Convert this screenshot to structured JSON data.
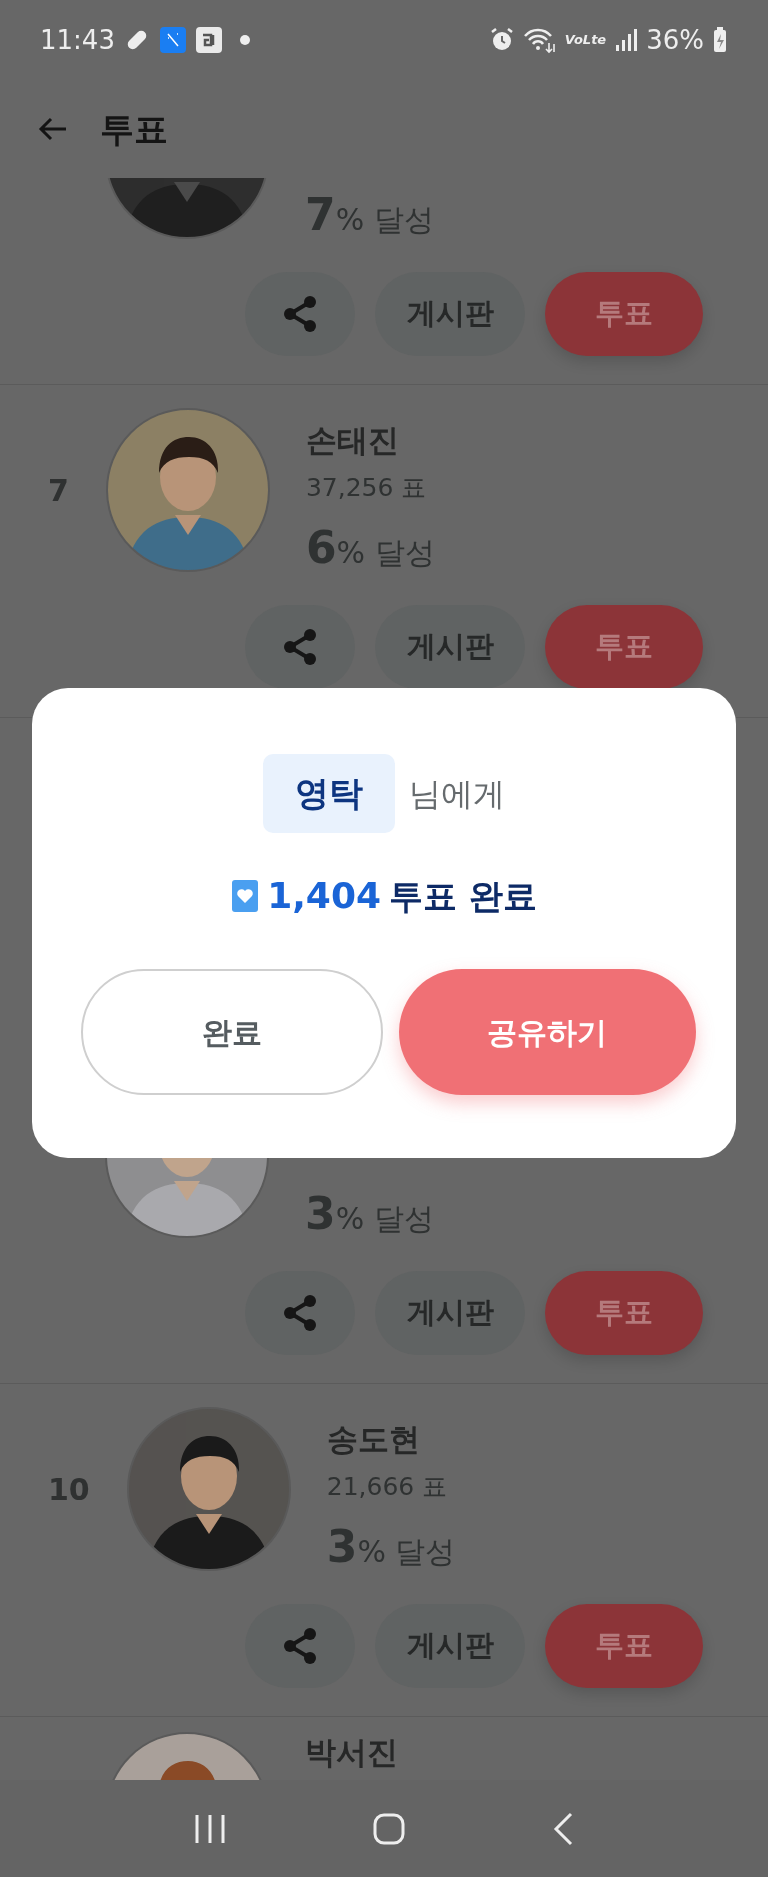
{
  "status_bar": {
    "time": "11:43",
    "network_label": "VoLte",
    "battery": "36%"
  },
  "header": {
    "title": "투표"
  },
  "candidates": [
    {
      "percent": "7",
      "percent_suffix": "% 달성",
      "board_label": "게시판",
      "vote_label": "투표"
    },
    {
      "rank": "7",
      "name": "손태진",
      "votes": "37,256 표",
      "percent": "6",
      "percent_suffix": "% 달성",
      "board_label": "게시판",
      "vote_label": "투표"
    },
    {
      "percent": "3",
      "percent_suffix": "% 달성",
      "board_label": "게시판",
      "vote_label": "투표"
    },
    {
      "rank": "10",
      "name": "송도현",
      "votes": "21,666 표",
      "percent": "3",
      "percent_suffix": "% 달성",
      "board_label": "게시판",
      "vote_label": "투표"
    },
    {
      "name": "박서진"
    }
  ],
  "dialog": {
    "recipient": "영탁",
    "recipient_suffix": "님에게",
    "vote_count": "1,404",
    "vote_label": "투표 완료",
    "buttons": [
      {
        "label": "완료",
        "kind": "secondary"
      },
      {
        "label": "공유하기",
        "kind": "primary"
      }
    ]
  }
}
